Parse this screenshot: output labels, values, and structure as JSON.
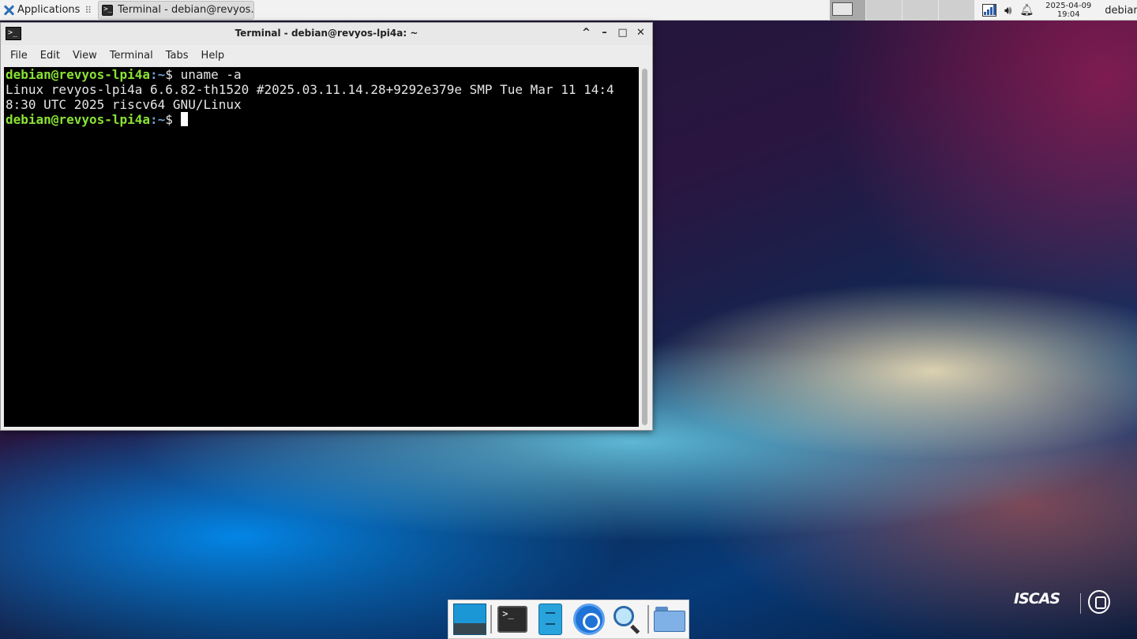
{
  "panel": {
    "applications_label": "Applications",
    "applications_sep": "⠿",
    "task_label": "Terminal - debian@revyos...",
    "task_icon_glyph": ">_",
    "clock_date": "2025-04-09",
    "clock_time": "19:04",
    "user": "debian",
    "workspaces": 4,
    "active_workspace": 1
  },
  "window": {
    "title": "Terminal - debian@revyos-lpi4a: ~",
    "icon_glyph": ">_",
    "controls": {
      "maximize_up": "^",
      "minimize": "–",
      "maximize": "□",
      "close": "✕"
    },
    "menu": [
      "File",
      "Edit",
      "View",
      "Terminal",
      "Tabs",
      "Help"
    ]
  },
  "terminal": {
    "prompt_user": "debian@revyos-lpi4a",
    "prompt_path": ":~",
    "prompt_symbol": "$ ",
    "command": "uname -a",
    "output_line1": "Linux revyos-lpi4a 6.6.82-th1520 #2025.03.11.14.28+9292e379e SMP Tue Mar 11 14:4",
    "output_line2": "8:30 UTC 2025 riscv64 GNU/Linux"
  },
  "dock": {
    "term_glyph": ">_",
    "items": [
      "show-desktop",
      "terminal",
      "file-manager",
      "web-browser",
      "app-finder",
      "home-folder"
    ]
  },
  "watermark": {
    "word": "ISCAS"
  },
  "colors": {
    "prompt_green": "#8ae234",
    "path_blue": "#729fcf",
    "terminal_bg": "#000000",
    "panel_bg": "#f2f2f2"
  }
}
